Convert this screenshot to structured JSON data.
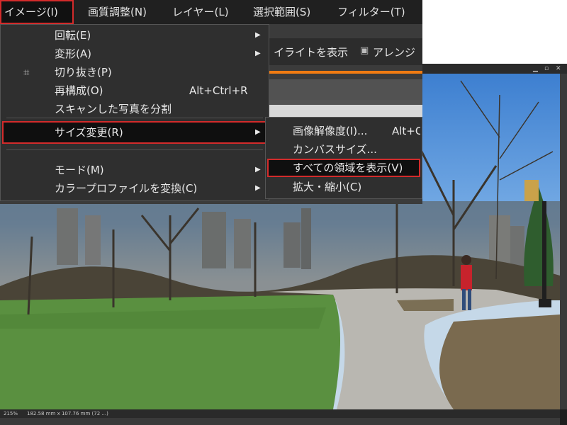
{
  "menubar": {
    "items": [
      {
        "label": "イメージ(I)"
      },
      {
        "label": "画質調整(N)"
      },
      {
        "label": "レイヤー(L)"
      },
      {
        "label": "選択範囲(S)"
      },
      {
        "label": "フィルター(T)"
      }
    ]
  },
  "toolbar": {
    "highlight_label": "イライトを表示",
    "arrange_label": "アレンジ"
  },
  "image_menu": {
    "items": [
      {
        "label": "回転(E)"
      },
      {
        "label": "変形(A)"
      },
      {
        "label": "切り抜き(P)"
      },
      {
        "label": "再構成(O)",
        "shortcut": "Alt+Ctrl+R"
      },
      {
        "label": "スキャンした写真を分割"
      },
      {
        "label": "サイズ変更(R)"
      },
      {
        "label": "モード(M)"
      },
      {
        "label": "カラープロファイルを変換(C)"
      }
    ]
  },
  "resize_submenu": {
    "items": [
      {
        "label": "画像解像度(I)...",
        "shortcut": "Alt+C"
      },
      {
        "label": "カンバスサイズ..."
      },
      {
        "label": "すべての領域を表示(V)"
      },
      {
        "label": "拡大・縮小(C)"
      }
    ]
  },
  "document": {
    "zoom": "215%",
    "size_info": "182.58 mm x 107.76 mm (72 ...)"
  },
  "icons": {
    "crop": "crop-icon",
    "submenu_arrow": "chevron-right-icon"
  },
  "colors": {
    "highlight_outline": "#d32b2b",
    "accent_orange": "#f07b12",
    "menu_bg": "#2f2f2f"
  }
}
